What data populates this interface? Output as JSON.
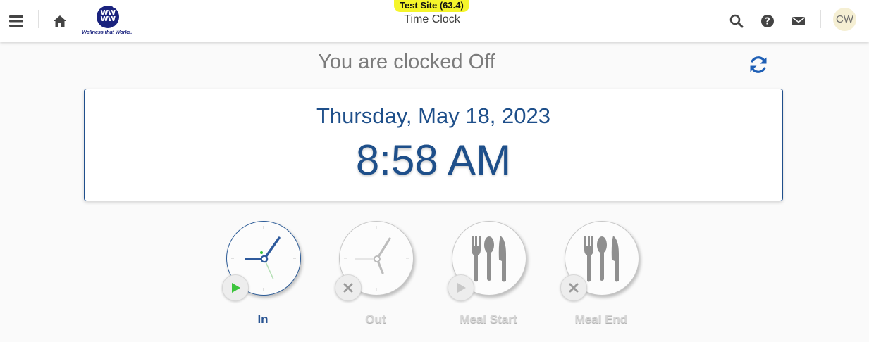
{
  "header": {
    "site_badge": "Test Site (63.4)",
    "page_title": "Time Clock",
    "logo_letters": "WW",
    "logo_tagline": "Wellness that Works.",
    "avatar_initials": "CW",
    "icons": [
      "menu-icon",
      "home-icon",
      "search-icon",
      "help-icon",
      "mail-icon"
    ]
  },
  "status": {
    "text": "You are clocked Off",
    "refresh_icon": "refresh-icon"
  },
  "clock": {
    "date": "Thursday, May 18, 2023",
    "time": "8:58 AM"
  },
  "punches": [
    {
      "label": "In",
      "enabled": true,
      "icon": "clock-icon",
      "badge_icon": "play-icon"
    },
    {
      "label": "Out",
      "enabled": false,
      "icon": "clock-icon",
      "badge_icon": "close-icon"
    },
    {
      "label": "Meal Start",
      "enabled": false,
      "icon": "utensils-icon",
      "badge_icon": "play-icon"
    },
    {
      "label": "Meal End",
      "enabled": false,
      "icon": "utensils-icon",
      "badge_icon": "close-icon"
    }
  ],
  "colors": {
    "accent": "#1e4f8a",
    "badge_bg": "#f5f52b",
    "play_green": "#3cc43c",
    "disabled": "#c8c8c8"
  }
}
